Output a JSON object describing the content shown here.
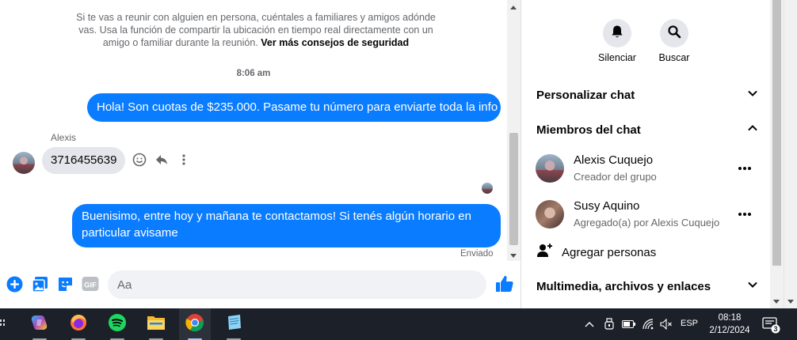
{
  "chat": {
    "safety_notice": "Si te vas a reunir con alguien en persona, cuéntales a familiares y amigos adónde vas. Usa la función de compartir la ubicación en tiempo real directamente con un amigo o familiar durante la reunión.",
    "safety_link": "Ver más consejos de seguridad",
    "time_separator": "8:06 am",
    "messages": [
      {
        "direction": "out",
        "text": "Hola! Son cuotas de $235.000. Pasame tu número para enviarte toda la info"
      },
      {
        "direction": "in",
        "sender": "Alexis",
        "text": "3716455639"
      },
      {
        "direction": "out",
        "text": "Buenisimo, entre hoy y mañana te contactamos! Si tenés algún horario en particular avisame"
      }
    ],
    "status": "Enviado",
    "composer": {
      "placeholder": "Aa"
    },
    "message_actions": [
      "emoji-icon",
      "reply-icon",
      "more-vertical-icon"
    ]
  },
  "composer_icons": [
    "plus-circle-icon",
    "photo-icon",
    "sticker-icon",
    "gif-icon",
    "emoji-icon",
    "thumbs-up-icon"
  ],
  "info": {
    "actions": [
      {
        "label": "Silenciar",
        "icon": "bell-icon"
      },
      {
        "label": "Buscar",
        "icon": "search-icon"
      }
    ],
    "sections": {
      "customize": "Personalizar chat",
      "members": "Miembros del chat",
      "media": "Multimedia, archivos y enlaces"
    },
    "members": [
      {
        "name": "Alexis Cuquejo",
        "role": "Creador del grupo"
      },
      {
        "name": "Susy Aquino",
        "role": "Agregado(a) por Alexis Cuquejo"
      }
    ],
    "add_people": "Agregar personas"
  },
  "taskbar": {
    "apps": [
      "copilot-icon",
      "firefox-icon",
      "spotify-icon",
      "file-explorer-icon",
      "chrome-icon",
      "notepad-icon"
    ],
    "language": "ESP",
    "time": "08:18",
    "date": "2/12/2024",
    "notification_count": "3"
  },
  "colors": {
    "accent": "#0a7cff",
    "bubble_in": "#e4e6eb",
    "taskbar": "#1c2028"
  }
}
